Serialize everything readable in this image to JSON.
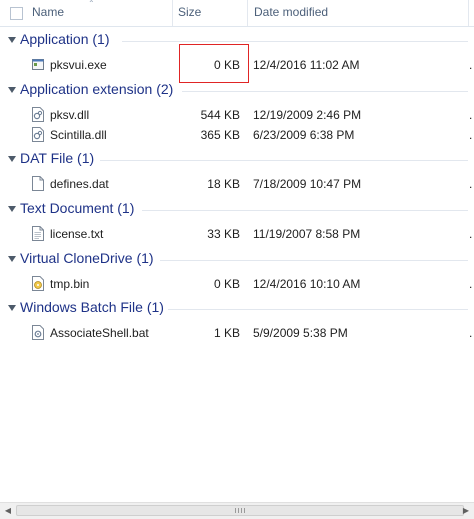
{
  "columns": {
    "name": "Name",
    "size": "Size",
    "date": "Date modified"
  },
  "groups": [
    {
      "title": "Application (1)",
      "files": [
        {
          "name": "pksvui.exe",
          "size": "0 KB",
          "date": "12/4/2016 11:02 AM",
          "icon": "exe-icon"
        }
      ]
    },
    {
      "title": "Application extension (2)",
      "files": [
        {
          "name": "pksv.dll",
          "size": "544 KB",
          "date": "12/19/2009 2:46 PM",
          "icon": "dll-icon"
        },
        {
          "name": "Scintilla.dll",
          "size": "365 KB",
          "date": "6/23/2009 6:38 PM",
          "icon": "dll-icon"
        }
      ]
    },
    {
      "title": "DAT File (1)",
      "files": [
        {
          "name": "defines.dat",
          "size": "18 KB",
          "date": "7/18/2009 10:47 PM",
          "icon": "file-icon"
        }
      ]
    },
    {
      "title": "Text Document (1)",
      "files": [
        {
          "name": "license.txt",
          "size": "33 KB",
          "date": "11/19/2007 8:58 PM",
          "icon": "text-file-icon"
        }
      ]
    },
    {
      "title": "Virtual CloneDrive (1)",
      "files": [
        {
          "name": "tmp.bin",
          "size": "0 KB",
          "date": "12/4/2016 10:10 AM",
          "icon": "bin-icon"
        }
      ]
    },
    {
      "title": "Windows Batch File (1)",
      "files": [
        {
          "name": "AssociateShell.bat",
          "size": "1 KB",
          "date": "5/9/2009 5:38 PM",
          "icon": "bat-icon"
        }
      ]
    }
  ],
  "colors": {
    "group_title": "#1e3287",
    "highlight": "#e02525",
    "header_text": "#4c607a"
  }
}
